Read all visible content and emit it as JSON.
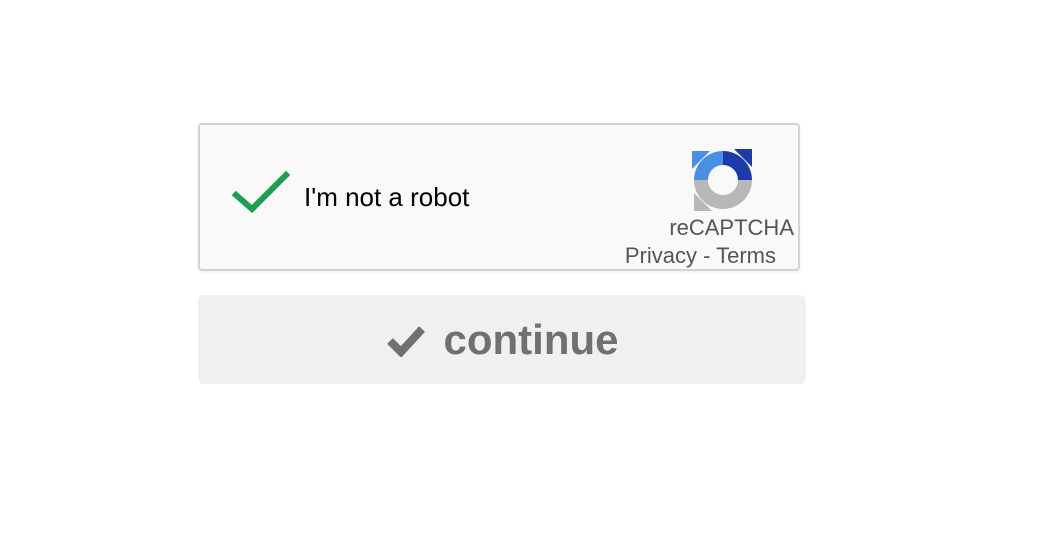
{
  "captcha": {
    "label": "I'm not a robot",
    "checked": true,
    "brand": "reCAPTCHA",
    "privacy_link": "Privacy",
    "separator": " - ",
    "terms_link": "Terms",
    "check_color": "#1f9d55"
  },
  "continue_button": {
    "label": "continue",
    "icon": "check-icon"
  },
  "colors": {
    "logo_blue_dark": "#1c3aa9",
    "logo_blue_light": "#4a90e2",
    "logo_gray": "#b8b8b8",
    "button_bg": "#f0f0f0",
    "button_text": "#707070"
  }
}
